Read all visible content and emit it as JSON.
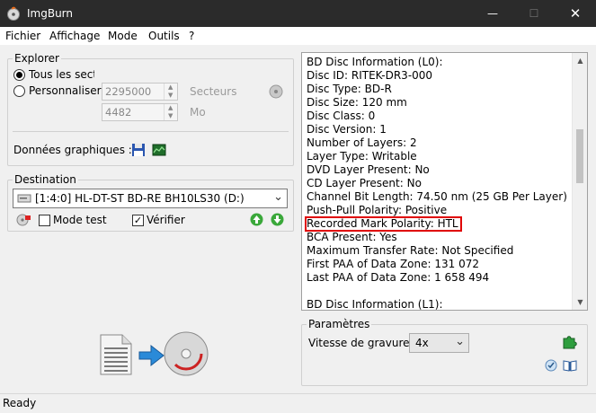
{
  "window": {
    "title": "ImgBurn"
  },
  "menu": [
    "Fichier",
    "Affichage",
    "Mode",
    "Outils",
    "?"
  ],
  "explorer": {
    "legend": "Explorer",
    "radio_all": "Tous les secteurs",
    "radio_custom": "Personnaliser",
    "sectors_value": "2295000",
    "sectors_unit": "Secteurs",
    "mo_value": "4482",
    "mo_unit": "Mo",
    "graph_label": "Données graphiques :"
  },
  "destination": {
    "legend": "Destination",
    "drive": "[1:4:0] HL-DT-ST BD-RE  BH10LS30 (D:)",
    "test_mode": "Mode test",
    "verify": "Vérifier",
    "verify_checked": true,
    "test_checked": false
  },
  "info": {
    "lines": [
      "BD Disc Information (L0):",
      "Disc ID: RITEK-DR3-000",
      "Disc Type: BD-R",
      "Disc Size: 120 mm",
      "Disc Class: 0",
      "Disc Version: 1",
      "Number of Layers: 2",
      "Layer Type: Writable",
      "DVD Layer Present: No",
      "CD Layer Present: No",
      "Channel Bit Length: 74.50 nm (25 GB Per Layer)",
      "Push-Pull Polarity: Positive",
      "Recorded Mark Polarity: HTL",
      "BCA Present: Yes",
      "Maximum Transfer Rate: Not Specified",
      "First PAA of Data Zone: 131 072",
      "Last PAA of Data Zone: 1 658 494",
      "",
      "BD Disc Information (L1):"
    ],
    "highlighted_line": "Recorded Mark Polarity: HTL"
  },
  "params": {
    "legend": "Paramètres",
    "speed_label": "Vitesse de gravure :",
    "speed_value": "4x"
  },
  "status": {
    "text": "Ready"
  },
  "icons": {
    "app": "disc-flame-icon",
    "highlight_color": "#e00000"
  }
}
